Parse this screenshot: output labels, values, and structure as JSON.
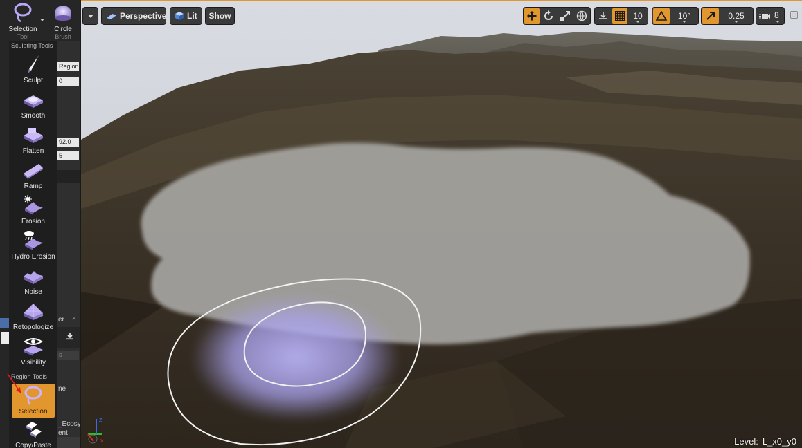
{
  "mode_bar": {
    "modes": [
      {
        "label": "Selection",
        "sub": "Tool",
        "icon": "lasso-icon"
      },
      {
        "label": "Circle",
        "sub": "Brush",
        "icon": "circle-brush-icon"
      }
    ]
  },
  "background_panel": {
    "field_region": "Region",
    "field_zero": "0",
    "field_value": "92.0",
    "field_small": "5",
    "tab_suffix": "er",
    "close_glyph": "×",
    "search_hint": "s",
    "row_ne": "ne",
    "row_ecosy": "_Ecosy",
    "row_ent": "ent"
  },
  "palette": {
    "sculpt_header": "Sculpting Tools",
    "region_header": "Region Tools",
    "sculpt_tools": [
      {
        "label": "Sculpt",
        "icon": "sculpt-icon"
      },
      {
        "label": "Smooth",
        "icon": "smooth-icon"
      },
      {
        "label": "Flatten",
        "icon": "flatten-icon"
      },
      {
        "label": "Ramp",
        "icon": "ramp-icon"
      },
      {
        "label": "Erosion",
        "icon": "erosion-icon"
      },
      {
        "label": "Hydro Erosion",
        "icon": "hydro-erosion-icon"
      },
      {
        "label": "Noise",
        "icon": "noise-icon"
      },
      {
        "label": "Retopologize",
        "icon": "retopologize-icon"
      },
      {
        "label": "Visibility",
        "icon": "visibility-icon"
      }
    ],
    "region_tools": [
      {
        "label": "Selection",
        "icon": "selection-icon",
        "active": true
      },
      {
        "label": "Copy/Paste",
        "icon": "copy-paste-icon"
      }
    ]
  },
  "viewport": {
    "toolbar": {
      "view_mode": "Perspective",
      "lighting": "Lit",
      "show": "Show",
      "grid_snap": "10",
      "rotation_snap": "10°",
      "scale_snap": "0.25",
      "camera_speed": "8"
    },
    "level": {
      "prefix": "Level:",
      "name": "L_x0_y0"
    }
  },
  "colors": {
    "accent": "#e2962e",
    "panel": "#2f2f2f",
    "palette": "#1e1e1e",
    "brush": "#b4aef0"
  }
}
